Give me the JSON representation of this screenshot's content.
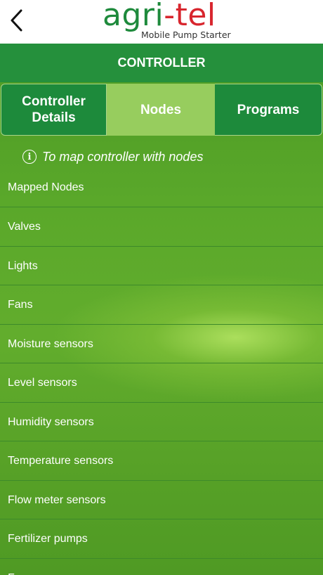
{
  "app": {
    "logo_main": "agri",
    "logo_accent": "-tel",
    "logo_tagline": "Mobile Pump Starter"
  },
  "header": {
    "title": "CONTROLLER"
  },
  "tabs": [
    {
      "label_line1": "Controller",
      "label_line2": "Details",
      "active": false
    },
    {
      "label_line1": "Nodes",
      "active": true
    },
    {
      "label_line1": "Programs",
      "active": false
    }
  ],
  "info": {
    "icon": "info-icon",
    "text": "To map controller with nodes"
  },
  "list": [
    "Mapped Nodes",
    "Valves",
    "Lights",
    "Fans",
    "Moisture sensors",
    "Level sensors",
    "Humidity sensors",
    "Temperature sensors",
    "Flow meter sensors",
    "Fertilizer pumps",
    "Foggers"
  ],
  "colors": {
    "header_bg": "#25903c",
    "tab_bg": "#1d8a3b",
    "tab_active_bg": "#97cd5e",
    "logo_green": "#1e8a3c",
    "logo_red": "#d8262e"
  }
}
